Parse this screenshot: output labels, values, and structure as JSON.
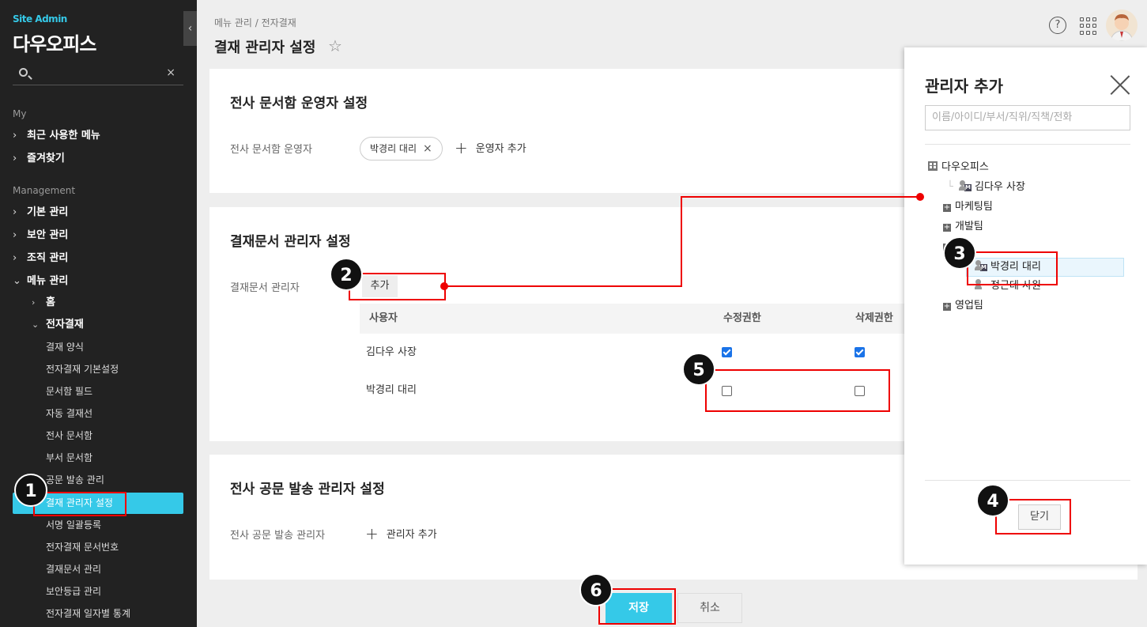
{
  "sidebar": {
    "site_label": "Site Admin",
    "brand": "다우오피스",
    "clear_icon": "×",
    "section_my": "My",
    "my_items": [
      "최근 사용한 메뉴",
      "즐겨찾기"
    ],
    "section_mgmt": "Management",
    "mgmt_items": [
      "기본 관리",
      "보안 관리",
      "조직 관리",
      "메뉴 관리"
    ],
    "sub_items": [
      "홈",
      "전자결재"
    ],
    "approval_items": [
      "결재 양식",
      "전자결재 기본설정",
      "문서함 필드",
      "자동 결재선",
      "전사 문서함",
      "부서 문서함",
      "공문 발송 관리",
      "결재 관리자 설정",
      "서명 일괄등록",
      "전자결재 문서번호",
      "결재문서 관리",
      "보안등급 관리",
      "전자결재 일자별 통계"
    ],
    "active_item": "결재 관리자 설정"
  },
  "header": {
    "breadcrumb": "메뉴 관리 / 전자결재",
    "title": "결재 관리자 설정",
    "help_glyph": "?"
  },
  "section1": {
    "title": "전사 문서함 운영자 설정",
    "label": "전사 문서함 운영자",
    "chip": "박경리 대리",
    "chip_remove": "×",
    "add_label": "운영자 추가"
  },
  "section2": {
    "title": "결재문서 관리자 설정",
    "label": "결재문서 관리자",
    "add_button": "추가",
    "columns": [
      "사용자",
      "수정권한",
      "삭제권한"
    ],
    "rows": [
      {
        "name": "김다우 사장",
        "edit": true,
        "delete": true
      },
      {
        "name": "박경리 대리",
        "edit": false,
        "delete": false
      }
    ]
  },
  "section3": {
    "title": "전사 공문 발송 관리자 설정",
    "label": "전사 공문 발송 관리자",
    "add_label": "관리자 추가"
  },
  "panel": {
    "title": "관리자 추가",
    "search_placeholder": "이름/아이디/부서/직위/직책/전화",
    "tree": {
      "root": "다우오피스",
      "ceo": "김다우 사장",
      "teams": [
        "마케팅팀",
        "개발팀",
        "팀",
        "영업팀"
      ],
      "members": [
        "박경리 대리",
        "정근데 사원"
      ]
    },
    "close_button": "닫기"
  },
  "footer": {
    "save": "저장",
    "cancel": "취소"
  },
  "annotations": [
    "1",
    "2",
    "3",
    "4",
    "5",
    "6"
  ],
  "colors": {
    "accent": "#35c9e8",
    "sidebar_bg": "#222222",
    "highlight": "#e00000"
  }
}
